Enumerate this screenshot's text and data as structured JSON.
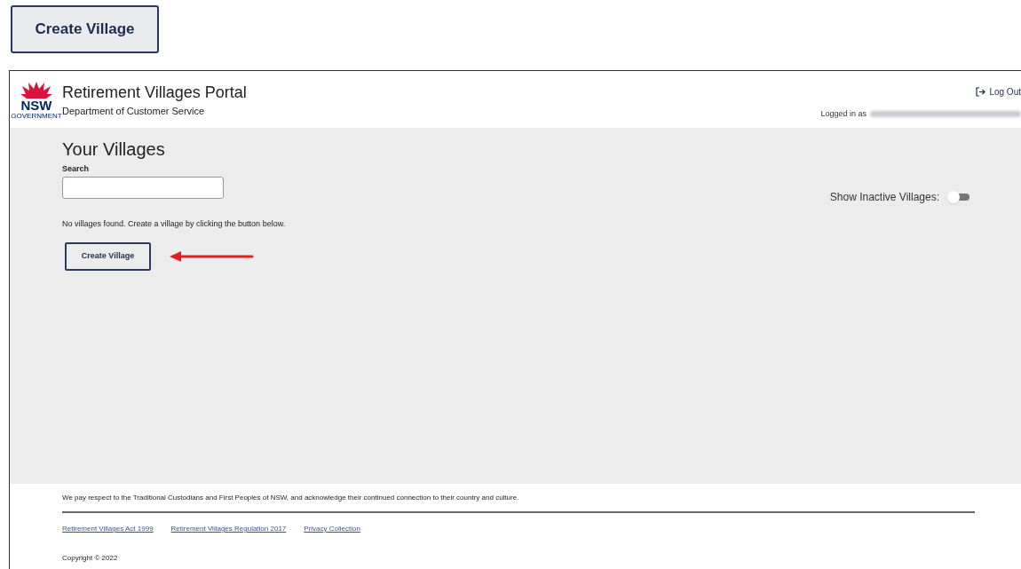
{
  "top_button": {
    "label": "Create Village"
  },
  "header": {
    "title": "Retirement Villages Portal",
    "subtitle": "Department of Customer Service",
    "logo_text": "NSW",
    "logo_subtext": "GOVERNMENT",
    "logout": "Log Out",
    "logged_in_label": "Logged in as"
  },
  "main": {
    "heading": "Your Villages",
    "search": {
      "label": "Search"
    },
    "inactive_toggle": {
      "label": "Show Inactive Villages:",
      "on": false
    },
    "empty_message": "No villages found. Create a village by clicking the button below.",
    "create_button": "Create Village"
  },
  "footer": {
    "acknowledgement": "We pay respect to the Traditional Custodians and First Peoples of NSW, and acknowledge their continued connection to their country and culture.",
    "links": [
      "Retirement Villages Act 1999",
      "Retirement Villages Regulation 2017",
      "Privacy Collection"
    ],
    "copyright": "Copyright © 2022"
  }
}
